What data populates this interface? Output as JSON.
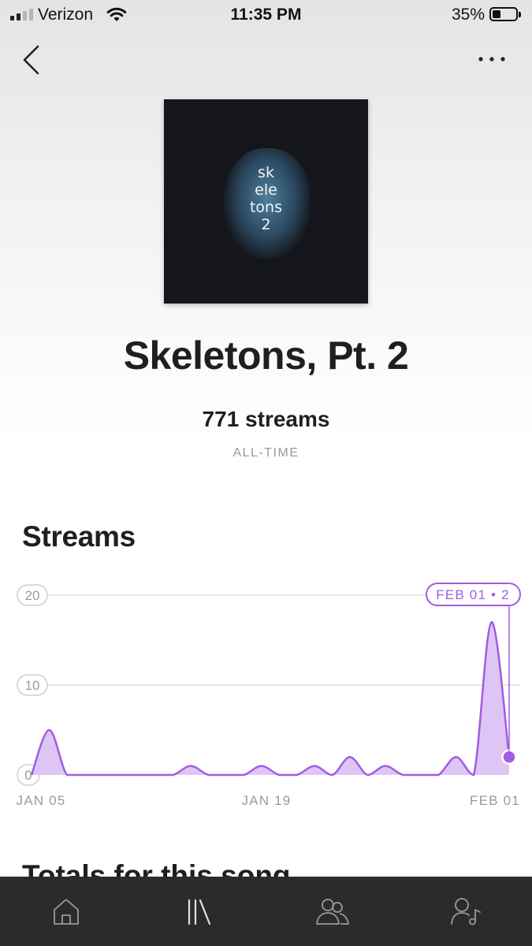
{
  "status_bar": {
    "carrier": "Verizon",
    "time": "11:35 PM",
    "battery": "35%",
    "battery_level": 0.35,
    "signal_bars": 2
  },
  "nav": {
    "back_icon": "chevron-left-icon",
    "more_icon": "ellipsis-icon"
  },
  "album": {
    "art_text": "sk\nele\ntons\n2"
  },
  "song": {
    "title": "Skeletons, Pt. 2",
    "streams": "771 streams",
    "period": "ALL-TIME"
  },
  "sections": {
    "streams_title": "Streams",
    "totals_title": "Totals for this song"
  },
  "chart_data": {
    "type": "area",
    "x_ticks": [
      "JAN 05",
      "JAN 19",
      "FEB 01"
    ],
    "y_ticks": [
      0,
      10,
      20
    ],
    "ylim": [
      0,
      20
    ],
    "x": [
      "Jan 05",
      "Jan 06",
      "Jan 07",
      "Jan 08",
      "Jan 09",
      "Jan 10",
      "Jan 11",
      "Jan 12",
      "Jan 13",
      "Jan 14",
      "Jan 15",
      "Jan 16",
      "Jan 17",
      "Jan 18",
      "Jan 19",
      "Jan 20",
      "Jan 21",
      "Jan 22",
      "Jan 23",
      "Jan 24",
      "Jan 25",
      "Jan 26",
      "Jan 27",
      "Jan 28",
      "Jan 29",
      "Jan 30",
      "Jan 31",
      "Feb 01"
    ],
    "values": [
      0,
      5,
      0,
      0,
      0,
      0,
      0,
      0,
      0,
      1,
      0,
      0,
      0,
      1,
      0,
      0,
      1,
      0,
      2,
      0,
      1,
      0,
      0,
      0,
      2,
      0,
      17,
      2
    ],
    "selected_label": "FEB 01 • 2",
    "color": "#a35be0",
    "fill_color": "#ddc6f5",
    "grid": true
  },
  "tabs": [
    {
      "icon": "home-icon"
    },
    {
      "icon": "library-icon"
    },
    {
      "icon": "audience-icon"
    },
    {
      "icon": "artist-profile-icon"
    }
  ]
}
